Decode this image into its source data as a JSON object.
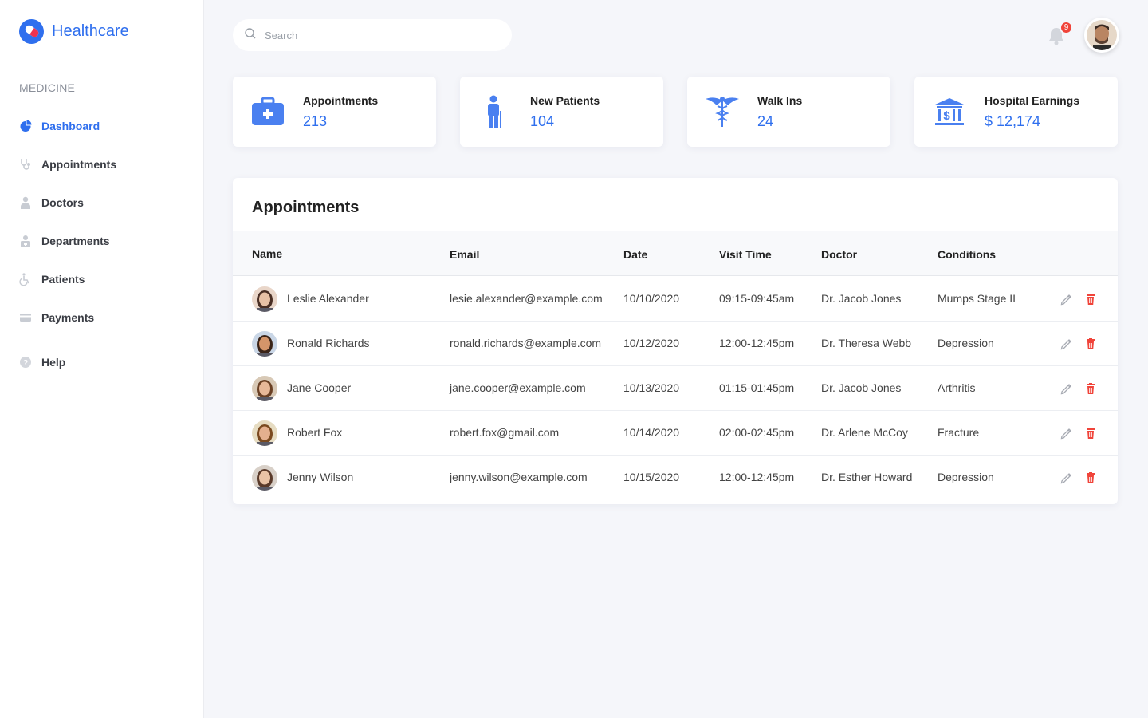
{
  "brand": {
    "name": "Healthcare",
    "accent": "#2f6fee"
  },
  "sidebar": {
    "section": "MEDICINE",
    "items": [
      {
        "label": "Dashboard",
        "icon": "pie-chart-icon",
        "active": true
      },
      {
        "label": "Appointments",
        "icon": "stethoscope-icon"
      },
      {
        "label": "Doctors",
        "icon": "doctor-icon"
      },
      {
        "label": "Departments",
        "icon": "department-icon"
      },
      {
        "label": "Patients",
        "icon": "wheelchair-icon"
      },
      {
        "label": "Payments",
        "icon": "credit-card-icon"
      }
    ],
    "help": {
      "label": "Help",
      "icon": "question-icon"
    }
  },
  "header": {
    "search_placeholder": "Search",
    "notifications": "9"
  },
  "stats": [
    {
      "title": "Appointments",
      "value": "213",
      "icon": "medical-kit-icon"
    },
    {
      "title": "New Patients",
      "value": "104",
      "icon": "patient-icon"
    },
    {
      "title": "Walk Ins",
      "value": "24",
      "icon": "caduceus-icon"
    },
    {
      "title": "Hospital Earnings",
      "value": "$ 12,174",
      "icon": "bank-icon"
    }
  ],
  "appointments": {
    "title": "Appointments",
    "columns": [
      "Name",
      "Email",
      "Date",
      "Visit Time",
      "Doctor",
      "Conditions"
    ],
    "rows": [
      {
        "name": "Leslie Alexander",
        "email": "lesie.alexander@example.com",
        "date": "10/10/2020",
        "time": "09:15-09:45am",
        "doctor": "Dr. Jacob Jones",
        "condition": "Mumps Stage II"
      },
      {
        "name": "Ronald Richards",
        "email": "ronald.richards@example.com",
        "date": "10/12/2020",
        "time": "12:00-12:45pm",
        "doctor": "Dr. Theresa Webb",
        "condition": "Depression"
      },
      {
        "name": "Jane Cooper",
        "email": "jane.cooper@example.com",
        "date": "10/13/2020",
        "time": "01:15-01:45pm",
        "doctor": "Dr. Jacob Jones",
        "condition": "Arthritis"
      },
      {
        "name": "Robert Fox",
        "email": "robert.fox@gmail.com",
        "date": "10/14/2020",
        "time": "02:00-02:45pm",
        "doctor": "Dr. Arlene McCoy",
        "condition": "Fracture"
      },
      {
        "name": "Jenny Wilson",
        "email": "jenny.wilson@example.com",
        "date": "10/15/2020",
        "time": "12:00-12:45pm",
        "doctor": "Dr. Esther Howard",
        "condition": "Depression"
      }
    ]
  }
}
